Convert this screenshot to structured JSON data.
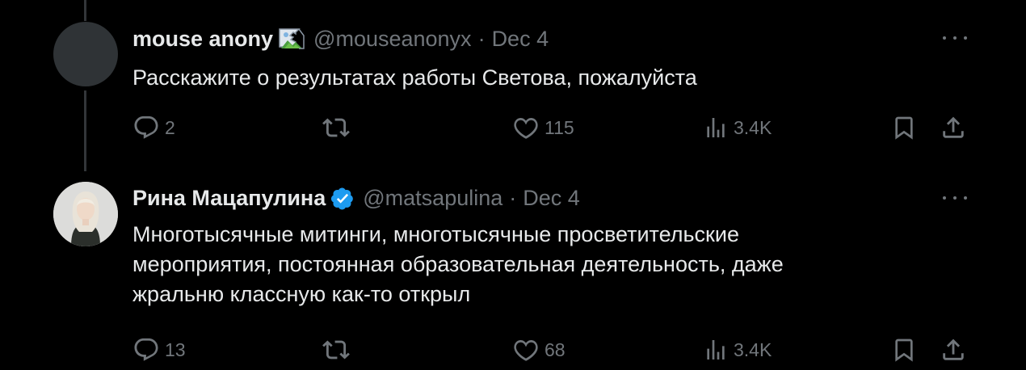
{
  "tweets": [
    {
      "author": "mouse anony",
      "handle": "@mouseanonyx",
      "separator": "·",
      "date": "Dec 4",
      "text": "Расскажите о результатах работы Светова, пожалуйста",
      "has_broken_image_badge": true,
      "replies": "2",
      "likes": "115",
      "views": "3.4K"
    },
    {
      "author": "Рина Мацапулина",
      "handle": "@matsapulina",
      "separator": "·",
      "date": "Dec 4",
      "text_lines": [
        "Многотысячные митинги, многотысячные просветительские",
        "мероприятия, постоянная образовательная деятельность, даже",
        "жральню классную как-то открыл"
      ],
      "verified": true,
      "replies": "13",
      "likes": "68",
      "views": "3.4K"
    }
  ],
  "colors": {
    "background": "#000000",
    "text": "#e7e9ea",
    "muted": "#71767b",
    "verified": "#1d9bf0"
  }
}
